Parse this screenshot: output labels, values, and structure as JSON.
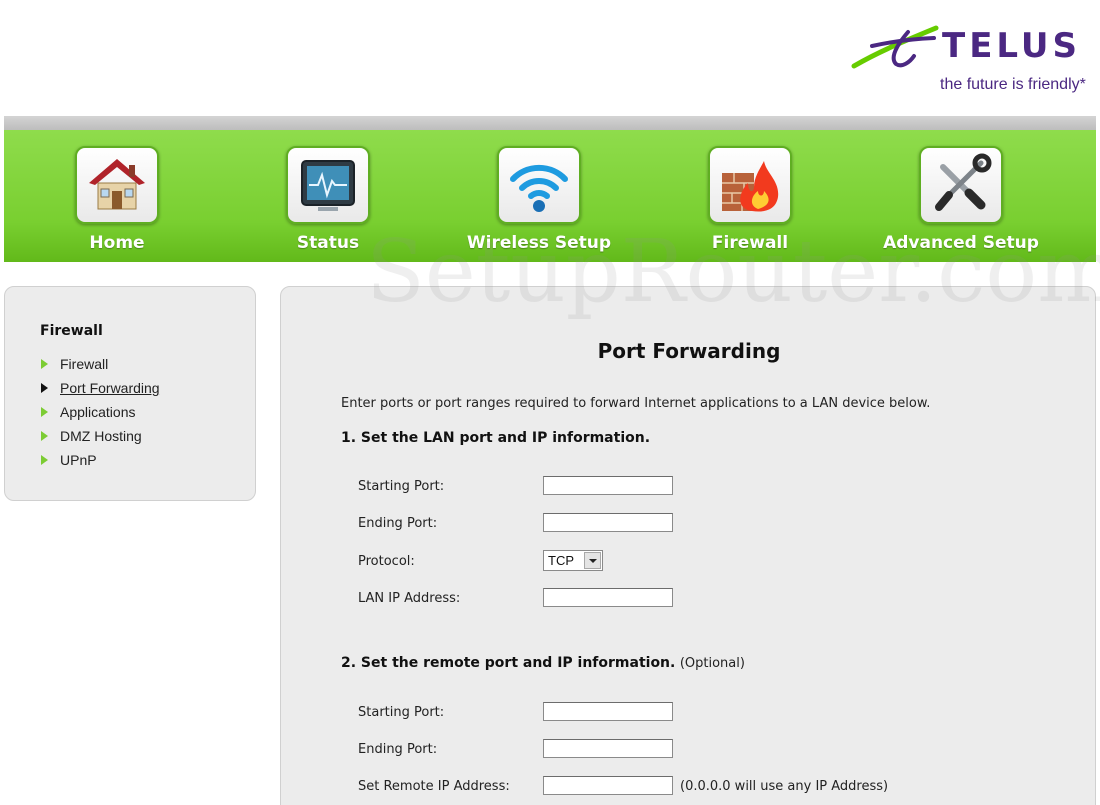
{
  "brand": {
    "name": "TELUS",
    "tagline": "the future is friendly*",
    "colors": {
      "purple": "#4b2882",
      "green": "#66cc00"
    }
  },
  "nav": {
    "accent": "#79cf30",
    "items": [
      {
        "label": "Home",
        "icon": "house-icon"
      },
      {
        "label": "Status",
        "icon": "monitor-pulse-icon"
      },
      {
        "label": "Wireless Setup",
        "icon": "wifi-icon"
      },
      {
        "label": "Firewall",
        "icon": "firewall-icon"
      },
      {
        "label": "Advanced Setup",
        "icon": "tools-icon"
      }
    ]
  },
  "sidebar": {
    "title": "Firewall",
    "active_index": 1,
    "items": [
      {
        "label": "Firewall"
      },
      {
        "label": "Port Forwarding"
      },
      {
        "label": "Applications"
      },
      {
        "label": "DMZ Hosting"
      },
      {
        "label": "UPnP"
      }
    ]
  },
  "watermark": "SetupRouter.com",
  "main": {
    "title": "Port Forwarding",
    "intro": "Enter ports or port ranges required to forward Internet applications to a LAN device below.",
    "lan": {
      "heading": "1. Set the LAN port and IP information.",
      "starting_port": {
        "label": "Starting Port:",
        "value": ""
      },
      "ending_port": {
        "label": "Ending Port:",
        "value": ""
      },
      "protocol": {
        "label": "Protocol:",
        "value": "TCP"
      },
      "lan_ip": {
        "label": "LAN IP Address:",
        "value": ""
      }
    },
    "remote": {
      "heading": "2. Set the remote port and IP information.",
      "optional": "(Optional)",
      "starting_port": {
        "label": "Starting Port:",
        "value": ""
      },
      "ending_port": {
        "label": "Ending Port:",
        "value": ""
      },
      "remote_ip": {
        "label": "Set Remote IP Address:",
        "value": "",
        "hint": "(0.0.0.0 will use any IP Address)"
      }
    }
  }
}
